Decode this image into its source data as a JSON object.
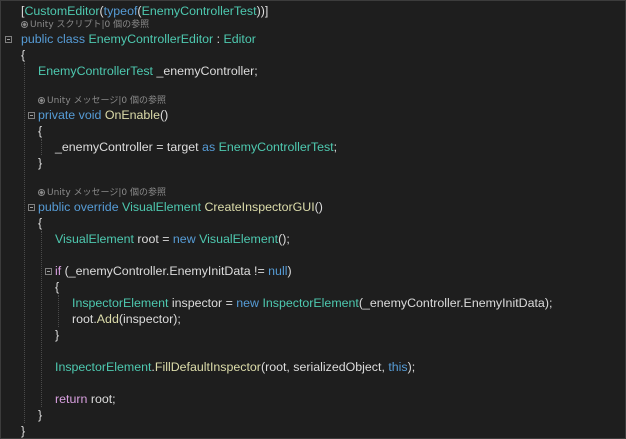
{
  "editor": {
    "colors": {
      "background": "#1e1e1e",
      "text": "#dcdcdc",
      "keyword": "#569cd6",
      "control": "#d8a0df",
      "type": "#4ec9b0",
      "method": "#dcdcaa",
      "codelens": "#8a8a8a"
    },
    "lines": [
      {
        "type": "code",
        "indent": 0,
        "tokens": [
          {
            "t": "[",
            "c": "text"
          },
          {
            "t": "CustomEditor",
            "c": "type"
          },
          {
            "t": "(",
            "c": "text"
          },
          {
            "t": "typeof",
            "c": "keyword"
          },
          {
            "t": "(",
            "c": "text"
          },
          {
            "t": "EnemyControllerTest",
            "c": "type"
          },
          {
            "t": "))]",
            "c": "text"
          }
        ]
      },
      {
        "type": "codelens",
        "indent": 0,
        "text": "Unity スクリプト|0 個の参照"
      },
      {
        "type": "code",
        "indent": 0,
        "fold": true,
        "tokens": [
          {
            "t": "public",
            "c": "keyword"
          },
          {
            "t": " ",
            "c": "text"
          },
          {
            "t": "class",
            "c": "keyword"
          },
          {
            "t": " ",
            "c": "text"
          },
          {
            "t": "EnemyControllerEditor",
            "c": "type"
          },
          {
            "t": " : ",
            "c": "text"
          },
          {
            "t": "Editor",
            "c": "type"
          }
        ]
      },
      {
        "type": "code",
        "indent": 0,
        "tokens": [
          {
            "t": "{",
            "c": "text"
          }
        ]
      },
      {
        "type": "code",
        "indent": 1,
        "tokens": [
          {
            "t": "EnemyControllerTest",
            "c": "type"
          },
          {
            "t": " _enemyController;",
            "c": "text"
          }
        ]
      },
      {
        "type": "code",
        "indent": 0,
        "tokens": []
      },
      {
        "type": "codelens",
        "indent": 1,
        "text": "Unity メッセージ|0 個の参照"
      },
      {
        "type": "code",
        "indent": 1,
        "fold": true,
        "tokens": [
          {
            "t": "private",
            "c": "keyword"
          },
          {
            "t": " ",
            "c": "text"
          },
          {
            "t": "void",
            "c": "keyword"
          },
          {
            "t": " ",
            "c": "text"
          },
          {
            "t": "OnEnable",
            "c": "method"
          },
          {
            "t": "()",
            "c": "text"
          }
        ]
      },
      {
        "type": "code",
        "indent": 1,
        "tokens": [
          {
            "t": "{",
            "c": "text"
          }
        ]
      },
      {
        "type": "code",
        "indent": 2,
        "tokens": [
          {
            "t": "_enemyController = target ",
            "c": "text"
          },
          {
            "t": "as",
            "c": "keyword"
          },
          {
            "t": " ",
            "c": "text"
          },
          {
            "t": "EnemyControllerTest",
            "c": "type"
          },
          {
            "t": ";",
            "c": "text"
          }
        ]
      },
      {
        "type": "code",
        "indent": 1,
        "tokens": [
          {
            "t": "}",
            "c": "text"
          }
        ]
      },
      {
        "type": "code",
        "indent": 0,
        "tokens": []
      },
      {
        "type": "codelens",
        "indent": 1,
        "text": "Unity メッセージ|0 個の参照"
      },
      {
        "type": "code",
        "indent": 1,
        "fold": true,
        "tokens": [
          {
            "t": "public",
            "c": "keyword"
          },
          {
            "t": " ",
            "c": "text"
          },
          {
            "t": "override",
            "c": "keyword"
          },
          {
            "t": " ",
            "c": "text"
          },
          {
            "t": "VisualElement",
            "c": "type"
          },
          {
            "t": " ",
            "c": "text"
          },
          {
            "t": "CreateInspectorGUI",
            "c": "method"
          },
          {
            "t": "()",
            "c": "text"
          }
        ]
      },
      {
        "type": "code",
        "indent": 1,
        "tokens": [
          {
            "t": "{",
            "c": "text"
          }
        ]
      },
      {
        "type": "code",
        "indent": 2,
        "tokens": [
          {
            "t": "VisualElement",
            "c": "type"
          },
          {
            "t": " root = ",
            "c": "text"
          },
          {
            "t": "new",
            "c": "keyword"
          },
          {
            "t": " ",
            "c": "text"
          },
          {
            "t": "VisualElement",
            "c": "type"
          },
          {
            "t": "();",
            "c": "text"
          }
        ]
      },
      {
        "type": "code",
        "indent": 0,
        "tokens": []
      },
      {
        "type": "code",
        "indent": 2,
        "fold": true,
        "tokens": [
          {
            "t": "if",
            "c": "control"
          },
          {
            "t": " (_enemyController.EnemyInitData != ",
            "c": "text"
          },
          {
            "t": "null",
            "c": "keyword"
          },
          {
            "t": ")",
            "c": "text"
          }
        ]
      },
      {
        "type": "code",
        "indent": 2,
        "tokens": [
          {
            "t": "{",
            "c": "text"
          }
        ]
      },
      {
        "type": "code",
        "indent": 3,
        "tokens": [
          {
            "t": "InspectorElement",
            "c": "type"
          },
          {
            "t": " inspector = ",
            "c": "text"
          },
          {
            "t": "new",
            "c": "keyword"
          },
          {
            "t": " ",
            "c": "text"
          },
          {
            "t": "InspectorElement",
            "c": "type"
          },
          {
            "t": "(_enemyController.EnemyInitData);",
            "c": "text"
          }
        ]
      },
      {
        "type": "code",
        "indent": 3,
        "tokens": [
          {
            "t": "root.",
            "c": "text"
          },
          {
            "t": "Add",
            "c": "method"
          },
          {
            "t": "(inspector);",
            "c": "text"
          }
        ]
      },
      {
        "type": "code",
        "indent": 2,
        "tokens": [
          {
            "t": "}",
            "c": "text"
          }
        ]
      },
      {
        "type": "code",
        "indent": 0,
        "tokens": []
      },
      {
        "type": "code",
        "indent": 2,
        "tokens": [
          {
            "t": "InspectorElement",
            "c": "type"
          },
          {
            "t": ".",
            "c": "text"
          },
          {
            "t": "FillDefaultInspector",
            "c": "method"
          },
          {
            "t": "(root, serializedObject, ",
            "c": "text"
          },
          {
            "t": "this",
            "c": "keyword"
          },
          {
            "t": ");",
            "c": "text"
          }
        ]
      },
      {
        "type": "code",
        "indent": 0,
        "tokens": []
      },
      {
        "type": "code",
        "indent": 2,
        "tokens": [
          {
            "t": "return",
            "c": "control"
          },
          {
            "t": " root;",
            "c": "text"
          }
        ]
      },
      {
        "type": "code",
        "indent": 1,
        "tokens": [
          {
            "t": "}",
            "c": "text"
          }
        ]
      },
      {
        "type": "code",
        "indent": 0,
        "tokens": [
          {
            "t": "}",
            "c": "text"
          }
        ]
      }
    ]
  }
}
